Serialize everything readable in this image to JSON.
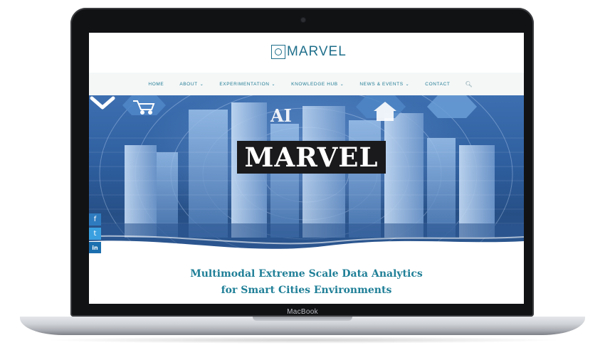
{
  "device": {
    "brand_label": "MacBook"
  },
  "site": {
    "logo_text": "MARVEL",
    "nav": [
      {
        "label": "HOME",
        "has_dropdown": false
      },
      {
        "label": "ABOUT",
        "has_dropdown": true
      },
      {
        "label": "EXPERIMENTATION",
        "has_dropdown": true
      },
      {
        "label": "KNOWLEDGE HUB",
        "has_dropdown": true
      },
      {
        "label": "NEWS & EVENTS",
        "has_dropdown": true
      },
      {
        "label": "CONTACT",
        "has_dropdown": false
      }
    ],
    "hero": {
      "title": "MARVEL",
      "overlay_labels": {
        "ai": "AI"
      }
    },
    "social": {
      "facebook": "f",
      "twitter": "t",
      "linkedin": "in"
    },
    "tagline": {
      "line1": "Multimodal Extreme Scale Data Analytics",
      "line2": "for Smart Cities Environments"
    },
    "colors": {
      "brand": "#1f6f8b",
      "accent": "#1f7f97",
      "hero": "#2e5e9e"
    }
  }
}
